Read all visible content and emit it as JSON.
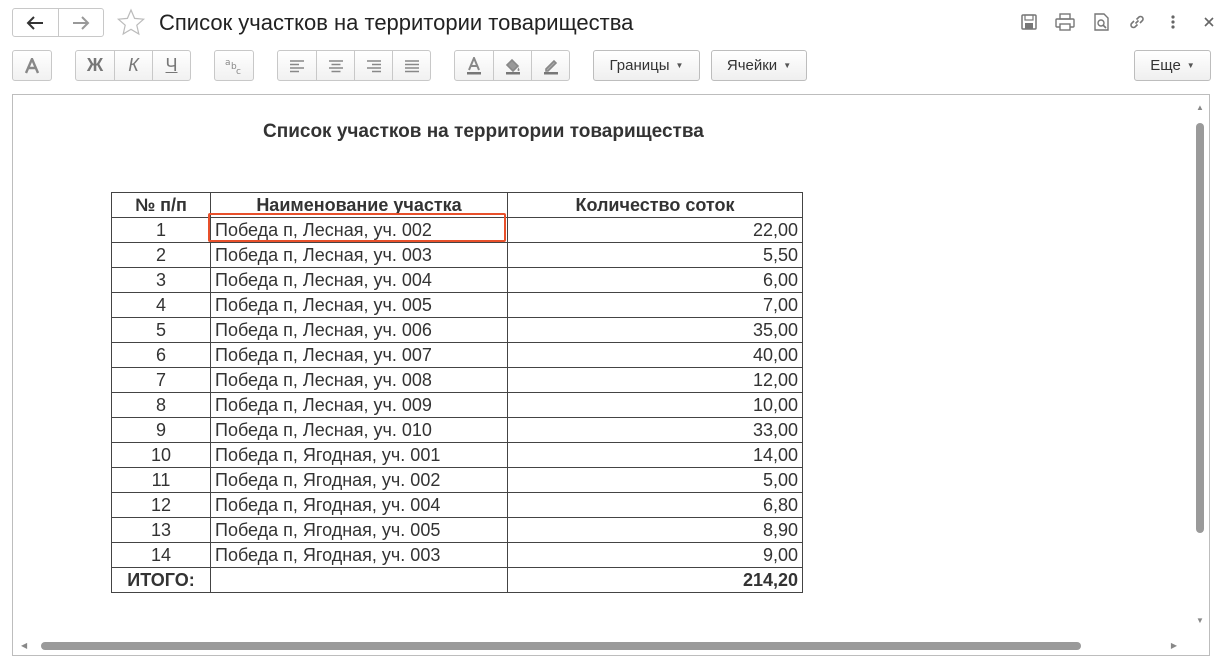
{
  "window": {
    "title": "Список участков на территории товарищества"
  },
  "toolbar": {
    "bold": "Ж",
    "italic": "К",
    "underline": "Ч",
    "borders": "Границы",
    "cells": "Ячейки",
    "more": "Еще"
  },
  "document": {
    "title": "Список участков на территории товарищества",
    "columns": [
      "№ п/п",
      "Наименование участка",
      "Количество соток"
    ],
    "rows": [
      {
        "n": "1",
        "name": "Победа п, Лесная, уч. 002",
        "area": "22,00"
      },
      {
        "n": "2",
        "name": "Победа п, Лесная, уч. 003",
        "area": "5,50"
      },
      {
        "n": "3",
        "name": "Победа п, Лесная, уч. 004",
        "area": "6,00"
      },
      {
        "n": "4",
        "name": "Победа п, Лесная, уч. 005",
        "area": "7,00"
      },
      {
        "n": "5",
        "name": "Победа п, Лесная, уч. 006",
        "area": "35,00"
      },
      {
        "n": "6",
        "name": "Победа п, Лесная, уч. 007",
        "area": "40,00"
      },
      {
        "n": "7",
        "name": "Победа п, Лесная, уч. 008",
        "area": "12,00"
      },
      {
        "n": "8",
        "name": "Победа п, Лесная, уч. 009",
        "area": "10,00"
      },
      {
        "n": "9",
        "name": "Победа п, Лесная, уч. 010",
        "area": "33,00"
      },
      {
        "n": "10",
        "name": "Победа п, Ягодная, уч. 001",
        "area": "14,00"
      },
      {
        "n": "11",
        "name": "Победа п, Ягодная, уч. 002",
        "area": "5,00"
      },
      {
        "n": "12",
        "name": "Победа п, Ягодная, уч. 004",
        "area": "6,80"
      },
      {
        "n": "13",
        "name": "Победа п, Ягодная, уч. 005",
        "area": "8,90"
      },
      {
        "n": "14",
        "name": "Победа п, Ягодная, уч. 003",
        "area": "9,00"
      }
    ],
    "total": {
      "label": "ИТОГО:",
      "value": "214,20"
    }
  },
  "colors": {
    "highlight": "#e8502b"
  }
}
